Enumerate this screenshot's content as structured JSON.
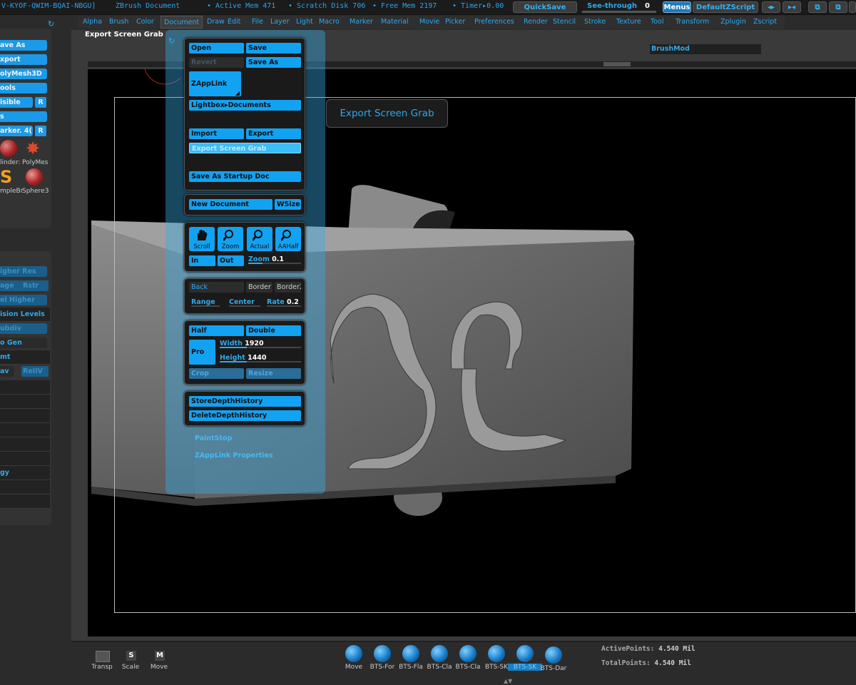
{
  "titlebar": {
    "doc_id": "V-KYOF-QWIM-BQAI-NBGU]",
    "doc_name": "ZBrush Document",
    "active_mem": "• Active Mem 471",
    "scratch_disk": "• Scratch Disk 706",
    "free_mem": "• Free Mem 2197",
    "timer": "• Timer▸0.00",
    "quicksave": "QuickSave",
    "see_through_label": "See-through",
    "see_through_value": "0",
    "menus": "Menus",
    "default_zscript": "DefaultZScript"
  },
  "menubar": {
    "items": [
      "Alpha",
      "Brush",
      "Color",
      "Document",
      "Draw",
      "Edit",
      "File",
      "Layer",
      "Light",
      "Macro",
      "Marker",
      "Material",
      "Movie",
      "Picker",
      "Preferences",
      "Render",
      "Stencil",
      "Stroke",
      "Texture",
      "Tool",
      "Transform",
      "Zplugin",
      "Zscript"
    ],
    "active": "Document"
  },
  "status": {
    "tooltip_title": "Export Screen Grab",
    "brush_mod": "BrushMod"
  },
  "left_tray": {
    "top_items": [
      "ave As",
      "xport",
      "olyMesh3D",
      "ools",
      "isible",
      "s",
      "arker. 4("
    ],
    "r_label": "R",
    "tool_thumbs": [
      "linder:",
      "PolyMes",
      "mpleBr",
      "Sphere3"
    ],
    "bottom_items": [
      "igher Res",
      "age",
      "Rstr",
      "el Higher",
      "ision Levels",
      "ubdiv",
      "o Gen",
      "mt",
      "av",
      "RelIV",
      "gy"
    ]
  },
  "document_palette": {
    "open": "Open",
    "save": "Save",
    "revert": "Revert",
    "save_as": "Save As",
    "zapplink": "ZAppLink",
    "lightbox_documents": "Lightbox▸Documents",
    "import": "Import",
    "export": "Export",
    "export_screen_grab": "Export Screen Grab",
    "save_as_startup": "Save As Startup Doc",
    "new_document": "New Document",
    "wsize": "WSize",
    "scroll": "Scroll",
    "zoom": "Zoom",
    "actual": "Actual",
    "aahalf": "AAHalf",
    "in": "In",
    "out": "Out",
    "zoom_slider_label": "Zoom",
    "zoom_slider_value": "0.1",
    "back": "Back",
    "border": "Border",
    "border2": "Border2",
    "range": "Range",
    "center": "Center",
    "rate_label": "Rate",
    "rate_value": "0.2",
    "half": "Half",
    "double": "Double",
    "pro": "Pro",
    "width_label": "Width",
    "width_value": "1920",
    "height_label": "Height",
    "height_value": "1440",
    "crop": "Crop",
    "resize": "Resize",
    "store_depth": "StoreDepthHistory",
    "delete_depth": "DeleteDepthHistory",
    "paint_stop": "PaintStop",
    "zapplink_properties": "ZAppLink Properties"
  },
  "bottom_shelf": {
    "transp": "Transp",
    "scale": "Scale",
    "move_tool": "Move",
    "brushes": [
      "Move",
      "BTS-For",
      "BTS-Fla",
      "BTS-Cla",
      "BTS-Cla",
      "BTS-SK",
      "BTS-SK",
      "BTS-Dar"
    ],
    "selected_brush_index": 6,
    "active_points_label": "ActivePoints:",
    "active_points_value": "4.540 Mil",
    "total_points_label": "TotalPoints:",
    "total_points_value": "4.540 Mil"
  },
  "colors": {
    "accent": "#12a2f2",
    "panel_bg": "#1a1a1a",
    "palette_overlay": "#3aaae4"
  }
}
